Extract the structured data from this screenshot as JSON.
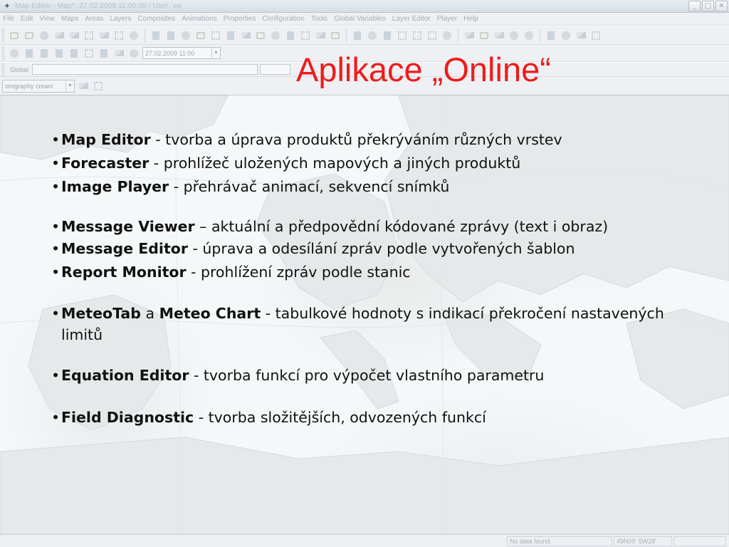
{
  "window": {
    "title": "Map Editor - Map*: 27.02.2009 11:00:00 / User: vw",
    "min_btn": "_",
    "max_btn": "□",
    "close_btn": "✕"
  },
  "menu": [
    "File",
    "Edit",
    "View",
    "Maps",
    "Areas",
    "Layers",
    "Composites",
    "Animations",
    "Properties",
    "Configuration",
    "Tools",
    "Global Variables",
    "Layer Editor",
    "Player",
    "Help"
  ],
  "toolbar": {
    "date_value": "27.02.2009 11:00",
    "scope_label": "Global",
    "layer_value": "orography cream"
  },
  "slide": {
    "title": "Aplikace „Online“",
    "bullets": {
      "map_editor": {
        "name": "Map Editor",
        "desc": " - tvorba a úprava produktů překrýváním různých vrstev"
      },
      "forecaster": {
        "name": "Forecaster",
        "desc": " - prohlížeč uložených mapových a jiných produktů"
      },
      "image_player": {
        "name": "Image Player",
        "desc": " - přehrávač animací, sekvencí snímků"
      },
      "message_viewer": {
        "name": "Message Viewer",
        "desc": " – aktuální a předpovědní kódované zprávy (text i obraz)"
      },
      "message_editor": {
        "name": "Message Editor",
        "desc": " - úprava a odesílání zpráv podle vytvořených šablon"
      },
      "report_monitor": {
        "name": "Report Monitor",
        "desc": " - prohlížení zpráv podle stanic"
      },
      "meteotab": {
        "name": "MeteoTab",
        "conj": " a ",
        "name2": "Meteo Chart",
        "desc": " - tabulkové hodnoty s indikací překročení nastavených limitů"
      },
      "equation_editor": {
        "name": "Equation Editor",
        "desc": " - tvorba funkcí pro výpočet vlastního parametru"
      },
      "field_diagnostic": {
        "name": "Field Diagnostic",
        "desc": " - tvorba složitějších, odvozených funkcí"
      }
    },
    "bullet_glyph": "•"
  },
  "status": {
    "message": "No data found.",
    "coords": "49N09' 5W28'"
  },
  "colors": {
    "title_red": "#ee1c1c",
    "text": "#111111",
    "sea": "#f4f8f9",
    "land": "#e9ebeb"
  },
  "icons": [
    "app-icon",
    "map-icon",
    "layer-icon",
    "settings-icon",
    "zoom-icon",
    "animation-icon",
    "calendar-icon",
    "grid-icon",
    "palette-icon"
  ]
}
